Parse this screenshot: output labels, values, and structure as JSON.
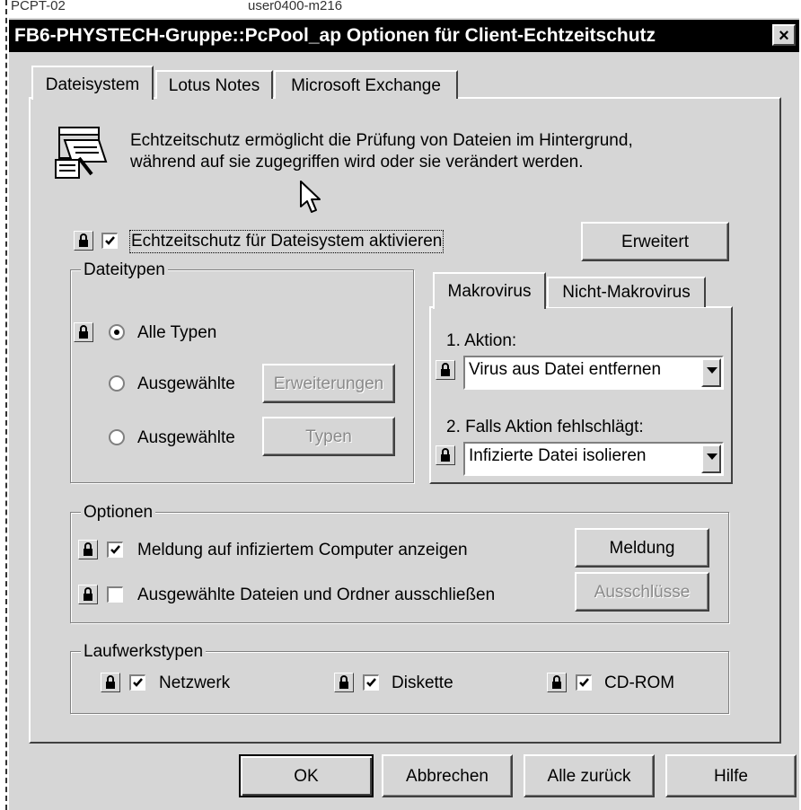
{
  "background": {
    "strip_left": "PCPT-02",
    "strip_right": "user0400-m216"
  },
  "titlebar": {
    "title": "FB6-PHYSTECH-Gruppe::PcPool_ap Optionen für Client-Echtzeitschutz",
    "close_glyph": "×"
  },
  "tabs": [
    {
      "label": "Dateisystem",
      "active": true
    },
    {
      "label": "Lotus Notes",
      "active": false
    },
    {
      "label": "Microsoft Exchange",
      "active": false
    }
  ],
  "intro": {
    "icon": "file-scan-icon",
    "line1": "Echtzeitschutz ermöglicht die Prüfung von Dateien im Hintergrund,",
    "line2": "während auf sie zugegriffen wird oder sie verändert werden."
  },
  "enable": {
    "label": "Echtzeitschutz für Dateisystem aktivieren",
    "checked": true,
    "advanced_button": "Erweitert"
  },
  "dateitypen": {
    "title": "Dateitypen",
    "all_types": "Alle Typen",
    "selected1": "Ausgewählte",
    "selected2": "Ausgewählte",
    "extensions_button": "Erweiterungen",
    "types_button": "Typen",
    "selected_option": "all"
  },
  "virus_tabs": [
    {
      "label": "Makrovirus",
      "active": true
    },
    {
      "label": "Nicht-Makrovirus",
      "active": false
    }
  ],
  "actions": {
    "action1_label": "1. Aktion:",
    "action1_value": "Virus aus Datei entfernen",
    "action2_label": "2. Falls Aktion fehlschlägt:",
    "action2_value": "Infizierte Datei isolieren"
  },
  "optionen": {
    "title": "Optionen",
    "show_message": "Meldung auf infiziertem Computer anzeigen",
    "show_message_checked": true,
    "exclude": "Ausgewählte Dateien und Ordner ausschließen",
    "exclude_checked": false,
    "message_button": "Meldung",
    "exclusions_button": "Ausschlüsse"
  },
  "laufwerkstypen": {
    "title": "Laufwerkstypen",
    "network": "Netzwerk",
    "floppy": "Diskette",
    "cdrom": "CD-ROM"
  },
  "footer": {
    "ok": "OK",
    "cancel": "Abbrechen",
    "reset_all": "Alle zurück",
    "help": "Hilfe"
  }
}
